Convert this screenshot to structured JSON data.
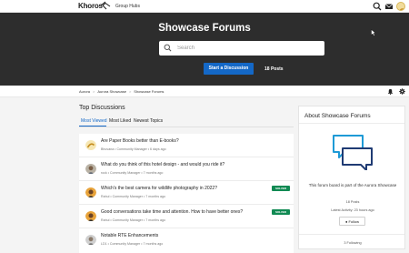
{
  "topnav": {
    "logo_text": "Khoros",
    "group_link": "Group Hubs",
    "icons": [
      "search-icon",
      "mail-icon",
      "user-avatar"
    ]
  },
  "hero": {
    "title": "Showcase Forums",
    "search_placeholder": "Search",
    "start_button": "Start a Discussion",
    "posts_count": "18 Posts",
    "background": "#2d2d2d",
    "accent": "#1468c7"
  },
  "breadcrumb": {
    "items": [
      "Aurora",
      "Aurora Showcase",
      "Showcase Forums"
    ],
    "separator": ">"
  },
  "discussions": {
    "title": "Top Discussions",
    "tabs": [
      "Most Viewed",
      "Most Liked",
      "Newest Topics"
    ],
    "active_tab": "Most Viewed",
    "items": [
      {
        "title": "Are Paper Books better than E-books?",
        "meta": "Bhuvana • Community Manager • 6 days ago",
        "solved": ""
      },
      {
        "title": "What do you think of this hotel design - and would you ride it?",
        "meta": "rock • Community Manager • 7 months ago",
        "solved": ""
      },
      {
        "title": "Which's the best camera for wildlife photography in 2022?",
        "meta": "Rahul • Community Manager • 7 months ago",
        "solved": "SOLVED"
      },
      {
        "title": "Good conversations take time and attention. How to have better ones?",
        "meta": "Rahul • Community Manager • 7 months ago",
        "solved": "SOLVED"
      },
      {
        "title": "Notable RTE Enhancements",
        "meta": "LD1 • Community Manager • 7 months ago",
        "solved": ""
      }
    ]
  },
  "about": {
    "title": "About Showcase Forums",
    "description": "This forum board is part of the Aurora Showcase",
    "posts": "18 Posts",
    "latest_activity": "Latest Activity: 23 hours ago",
    "follow_button": "Follow",
    "following": "3 Following",
    "icon": "chat-bubbles-icon"
  }
}
